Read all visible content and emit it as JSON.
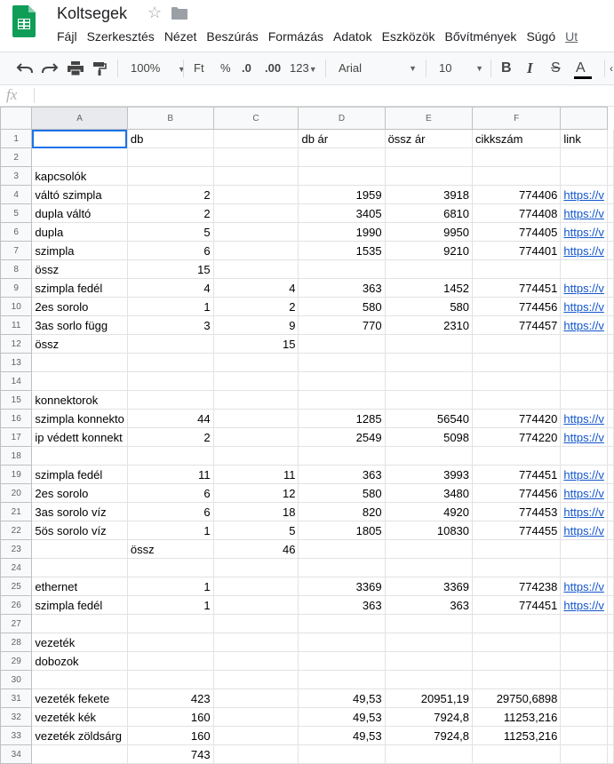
{
  "app": {
    "title": "Koltsegek",
    "menu": [
      "Fájl",
      "Szerkesztés",
      "Nézet",
      "Beszúrás",
      "Formázás",
      "Adatok",
      "Eszközök",
      "Bővítmények",
      "Súgó",
      "Ut"
    ],
    "logo_color": "#0f9d58"
  },
  "toolbar": {
    "zoom": "100%",
    "currency": "Ft",
    "percent": "%",
    "dec_less": ".0",
    "dec_more": ".00",
    "more_formats": "123",
    "font": "Arial",
    "size": "10",
    "bold": "B",
    "italic": "I",
    "strike": "S",
    "text_color": "A"
  },
  "formula_bar": {
    "fx": "fx",
    "value": ""
  },
  "columns": [
    "A",
    "B",
    "C",
    "D",
    "E",
    "F",
    ""
  ],
  "rows": [
    {
      "n": "1",
      "cells": [
        "",
        "db",
        "",
        "db ár",
        "össz ár",
        "cikkszám",
        "link"
      ]
    },
    {
      "n": "2",
      "cells": [
        "",
        "",
        "",
        "",
        "",
        "",
        ""
      ]
    },
    {
      "n": "3",
      "cells": [
        "kapcsolók",
        "",
        "",
        "",
        "",
        "",
        ""
      ]
    },
    {
      "n": "4",
      "cells": [
        "váltó szimpla",
        "2",
        "",
        "1959",
        "3918",
        "774406",
        "https://v"
      ]
    },
    {
      "n": "5",
      "cells": [
        "dupla váltó",
        "2",
        "",
        "3405",
        "6810",
        "774408",
        "https://v"
      ]
    },
    {
      "n": "6",
      "cells": [
        "dupla",
        "5",
        "",
        "1990",
        "9950",
        "774405",
        "https://v"
      ]
    },
    {
      "n": "7",
      "cells": [
        "szimpla",
        "6",
        "",
        "1535",
        "9210",
        "774401",
        "https://v"
      ]
    },
    {
      "n": "8",
      "cells": [
        "össz",
        "15",
        "",
        "",
        "",
        "",
        ""
      ]
    },
    {
      "n": "9",
      "cells": [
        "szimpla fedél",
        "4",
        "4",
        "363",
        "1452",
        "774451",
        "https://v"
      ]
    },
    {
      "n": "10",
      "cells": [
        "2es sorolo",
        "1",
        "2",
        "580",
        "580",
        "774456",
        "https://v"
      ]
    },
    {
      "n": "11",
      "cells": [
        "3as sorlo függ",
        "3",
        "9",
        "770",
        "2310",
        "774457",
        "https://v"
      ]
    },
    {
      "n": "12",
      "cells": [
        "össz",
        "",
        "15",
        "",
        "",
        "",
        ""
      ]
    },
    {
      "n": "13",
      "cells": [
        "",
        "",
        "",
        "",
        "",
        "",
        ""
      ]
    },
    {
      "n": "14",
      "cells": [
        "",
        "",
        "",
        "",
        "",
        "",
        ""
      ]
    },
    {
      "n": "15",
      "cells": [
        "konnektorok",
        "",
        "",
        "",
        "",
        "",
        ""
      ]
    },
    {
      "n": "16",
      "cells": [
        "szimpla konnekto",
        "44",
        "",
        "1285",
        "56540",
        "774420",
        "https://v"
      ]
    },
    {
      "n": "17",
      "cells": [
        "ip védett konnekt",
        "2",
        "",
        "2549",
        "5098",
        "774220",
        "https://v"
      ]
    },
    {
      "n": "18",
      "cells": [
        "",
        "",
        "",
        "",
        "",
        "",
        ""
      ]
    },
    {
      "n": "19",
      "cells": [
        "szimpla fedél",
        "11",
        "11",
        "363",
        "3993",
        "774451",
        "https://v"
      ]
    },
    {
      "n": "20",
      "cells": [
        "2es sorolo",
        "6",
        "12",
        "580",
        "3480",
        "774456",
        "https://v"
      ]
    },
    {
      "n": "21",
      "cells": [
        "3as sorolo víz",
        "6",
        "18",
        "820",
        "4920",
        "774453",
        "https://v"
      ]
    },
    {
      "n": "22",
      "cells": [
        "5ös sorolo víz",
        "1",
        "5",
        "1805",
        "10830",
        "774455",
        "https://v"
      ]
    },
    {
      "n": "23",
      "cells": [
        "",
        "össz",
        "46",
        "",
        "",
        "",
        ""
      ]
    },
    {
      "n": "24",
      "cells": [
        "",
        "",
        "",
        "",
        "",
        "",
        ""
      ]
    },
    {
      "n": "25",
      "cells": [
        "ethernet",
        "1",
        "",
        "3369",
        "3369",
        "774238",
        "https://v"
      ]
    },
    {
      "n": "26",
      "cells": [
        "szimpla fedél",
        "1",
        "",
        "363",
        "363",
        "774451",
        "https://v"
      ]
    },
    {
      "n": "27",
      "cells": [
        "",
        "",
        "",
        "",
        "",
        "",
        ""
      ]
    },
    {
      "n": "28",
      "cells": [
        "vezeték",
        "",
        "",
        "",
        "",
        "",
        ""
      ]
    },
    {
      "n": "29",
      "cells": [
        "dobozok",
        "",
        "",
        "",
        "",
        "",
        ""
      ]
    },
    {
      "n": "30",
      "cells": [
        "",
        "",
        "",
        "",
        "",
        "",
        ""
      ]
    },
    {
      "n": "31",
      "cells": [
        "vezeték fekete",
        "423",
        "",
        "49,53",
        "20951,19",
        "29750,6898",
        ""
      ]
    },
    {
      "n": "32",
      "cells": [
        "vezeték kék",
        "160",
        "",
        "49,53",
        "7924,8",
        "11253,216",
        ""
      ]
    },
    {
      "n": "33",
      "cells": [
        "vezeték zöldsárg",
        "160",
        "",
        "49,53",
        "7924,8",
        "11253,216",
        ""
      ]
    },
    {
      "n": "34",
      "cells": [
        "",
        "743",
        "",
        "",
        "",
        "",
        ""
      ]
    }
  ]
}
